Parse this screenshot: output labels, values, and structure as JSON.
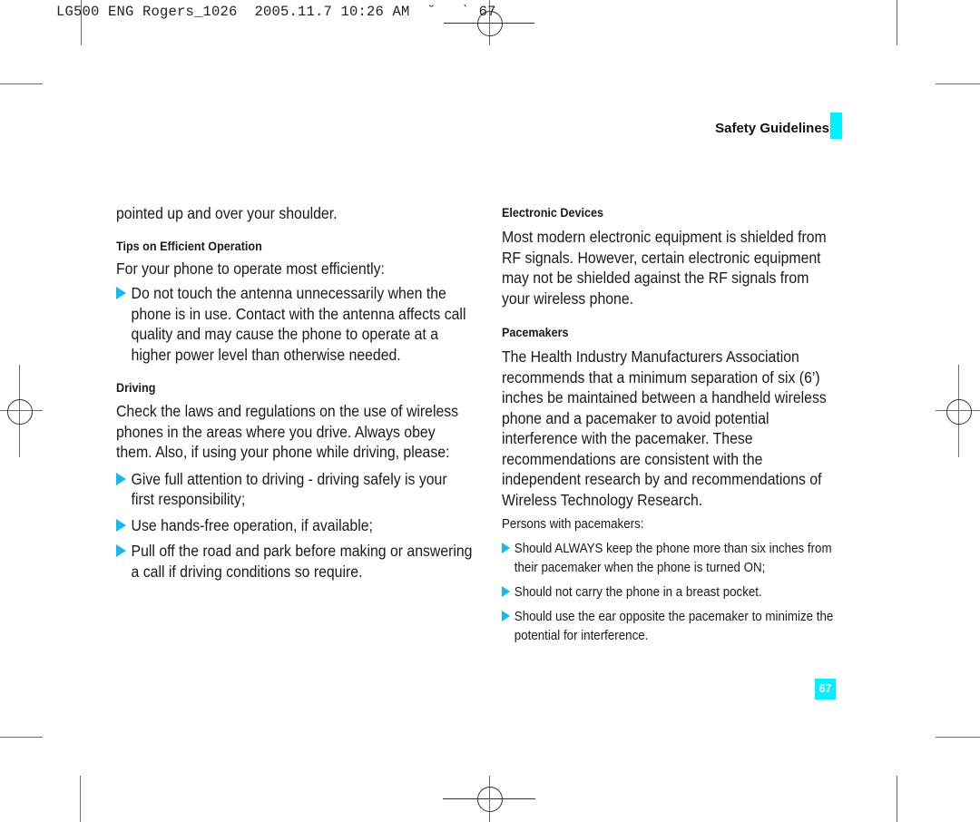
{
  "print_slug": {
    "text": "LG500 ENG Rogers_1026  2005.11.7 10:26 AM  ˘   ˋ 67"
  },
  "section_title": "Safety Guidelines",
  "page_number": "67",
  "accent_color": "#00f0ff",
  "bullet_color": "#16b8f0",
  "left_column": {
    "intro": "pointed up and over your shoulder.",
    "tips": {
      "heading": "Tips on Efficient Operation",
      "lead": "For your phone to operate most efficiently:",
      "bullets": [
        "Do not touch the antenna unnecessarily when the phone is in use. Contact with the antenna affects call quality and may cause the phone to operate at a higher power level than otherwise needed."
      ]
    },
    "driving": {
      "heading": "Driving",
      "lead": "Check the laws and regulations on the use of wireless phones in the areas where you drive. Always obey them. Also, if using your phone while driving, please:",
      "bullets": [
        "Give full attention to driving - driving safely is your first responsibility;",
        "Use hands-free operation, if available;",
        "Pull off the road and park before making or answering a call if driving conditions so require."
      ]
    }
  },
  "right_column": {
    "electronic": {
      "heading": "Electronic Devices",
      "body": "Most modern electronic equipment is shielded from RF signals. However, certain electronic equipment may not be shielded against the RF signals from your wireless phone."
    },
    "pacemakers": {
      "heading": "Pacemakers",
      "body": "The Health Industry Manufacturers Association recommends that a minimum separation of six (6’) inches be maintained between a handheld wireless phone and a pacemaker to avoid potential interference with the pacemaker. These recommendations are consistent with the independent research by and recommendations of Wireless Technology Research.",
      "persons_label": "Persons with pacemakers:",
      "bullets": [
        "Should ALWAYS keep the phone more than six inches from their pacemaker when the phone is turned ON;",
        "Should not carry the phone in a breast pocket.",
        "Should use the ear opposite the pacemaker to minimize the potential for interference."
      ]
    }
  }
}
